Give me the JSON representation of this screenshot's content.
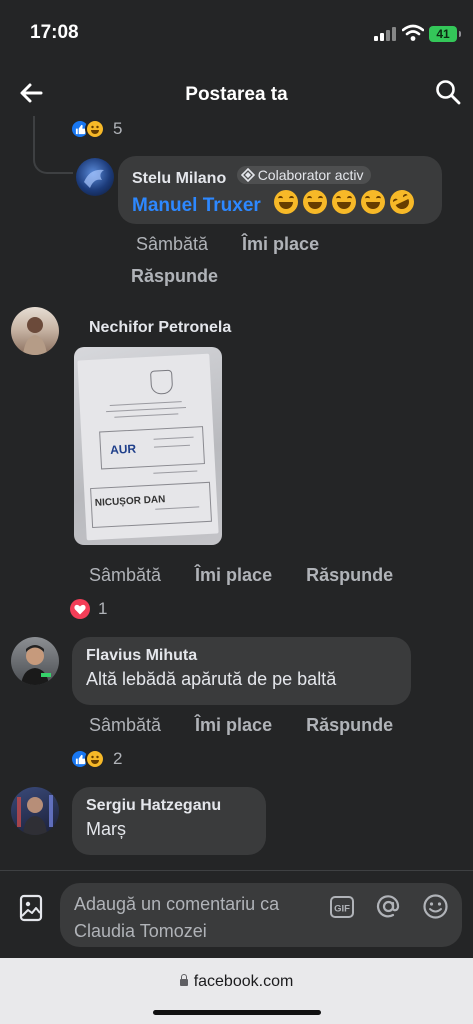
{
  "status_bar": {
    "time": "17:08",
    "battery": "41"
  },
  "header": {
    "title": "Postarea ta",
    "back_icon": "arrow-left-icon",
    "search_icon": "search-icon"
  },
  "reply_reactions": {
    "count": "5"
  },
  "comments": [
    {
      "author": "Stelu Milano",
      "badge": "Colaborator activ",
      "mention": "Manuel Truxer",
      "emoji": [
        "laughing",
        "laughing",
        "laughing",
        "laughing",
        "rofl"
      ],
      "actions": {
        "time": "Sâmbătă",
        "like": "Îmi place",
        "reply": "Răspunde"
      }
    },
    {
      "author": "Nechifor Petronela",
      "image": {
        "party": "AUR",
        "candidate": "NICUȘOR DAN"
      },
      "actions": {
        "time": "Sâmbătă",
        "like": "Îmi place",
        "reply": "Răspunde"
      },
      "reactions": {
        "types": [
          "heart"
        ],
        "count": "1"
      }
    },
    {
      "author": "Flavius Mihuta",
      "text": "Altă lebădă apărută de pe baltă",
      "actions": {
        "time": "Sâmbătă",
        "like": "Îmi place",
        "reply": "Răspunde"
      },
      "reactions": {
        "types": [
          "like",
          "grin"
        ],
        "count": "2"
      }
    },
    {
      "author": "Sergiu Hatzeganu",
      "text": "Marș"
    }
  ],
  "composer": {
    "placeholder": "Adaugă un comentariu ca Claudia Tomozei",
    "icons": [
      "image-icon",
      "gif-icon",
      "mention-icon",
      "emoji-icon"
    ]
  },
  "browser": {
    "url": "facebook.com"
  },
  "colors": {
    "background": "#242526",
    "bubble": "#3a3b3c",
    "link": "#2d88ff",
    "like": "#1877f2",
    "heart": "#f33e58"
  }
}
